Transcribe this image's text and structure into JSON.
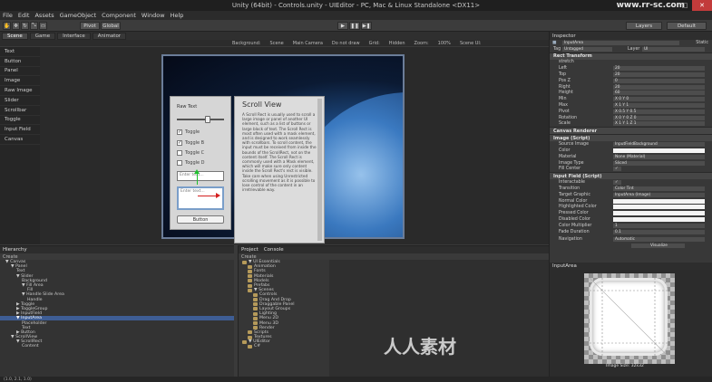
{
  "window": {
    "title": "Unity (64bit) - Controls.unity - UIEditor - PC, Mac & Linux Standalone <DX11>",
    "site": "www.rr-sc.com"
  },
  "menu": [
    "File",
    "Edit",
    "Assets",
    "GameObject",
    "Component",
    "Window",
    "Help"
  ],
  "toolbar": {
    "pivot": "Pivot",
    "global": "Global",
    "play": "▶",
    "pause": "❚❚",
    "step": "▶❚",
    "layers": "Layers",
    "layout": "Default"
  },
  "scene_tabs": [
    "Scene",
    "Game",
    "Interface",
    "Animator"
  ],
  "scene_options": {
    "background": "Background:",
    "scene": "Scene",
    "camera": "Main Camera",
    "do_not_draw": "Do not draw",
    "grid": "Grid:",
    "hidden": "Hidden",
    "zoom": "Zoom:",
    "zoom_val": "100%",
    "scene_ui": "Scene UI:"
  },
  "tools": [
    "Text",
    "Button",
    "Panel",
    "Image",
    "Raw Image",
    "Slider",
    "Scrollbar",
    "Toggle",
    "Input Field",
    "Canvas"
  ],
  "demo_ui": {
    "left_title": "Raw Text",
    "checkboxes": [
      "Toggle",
      "Toggle B",
      "Toggle C",
      "Toggle D"
    ],
    "input1": "Enter text...",
    "input2": "Enter text...",
    "button": "Button",
    "scroll_title": "Scroll View",
    "scroll_text": "A Scroll Rect is usually used to scroll a large image or panel of another UI element, such as a list of buttons or large block of text. The Scroll Rect is most often used with a mask element, and is designed to work seamlessly with scrollbars. To scroll content, the input must be received from inside the bounds of the ScrollRect, not on the content itself. The Scroll Rect is commonly used with a Mask element, which will make sure only content inside the Scroll Rect's rect is visible. Take care when using Unrestricted scrolling movement as it is possible to lose control of the content in an irretrievable way."
  },
  "inspector": {
    "tab": "Inspector",
    "name": "InputArea",
    "static": "Static",
    "tag": "Untagged",
    "layer": "UI",
    "rect_transform": "Rect Transform",
    "anchor_preset": "stretch",
    "rows": [
      {
        "label": "Left",
        "value": "20"
      },
      {
        "label": "Top",
        "value": "20"
      },
      {
        "label": "Pos Z",
        "value": "0"
      },
      {
        "label": "Right",
        "value": "20"
      },
      {
        "label": "Height",
        "value": "60"
      }
    ],
    "anchors": [
      {
        "label": "Min",
        "value": "X 0    Y 0"
      },
      {
        "label": "Max",
        "value": "X 1    Y 1"
      },
      {
        "label": "Pivot",
        "value": "X 0.5  Y 0.5"
      },
      {
        "label": "Rotation",
        "value": "X 0  Y 0  Z 0"
      },
      {
        "label": "Scale",
        "value": "X 1  Y 1  Z 1"
      }
    ],
    "canvas_renderer": "Canvas Renderer",
    "image_script": "Image (Script)",
    "image_rows": [
      {
        "label": "Source Image",
        "value": "InputFieldBackground"
      },
      {
        "label": "Color",
        "value": ""
      },
      {
        "label": "Material",
        "value": "None (Material)"
      },
      {
        "label": "Image Type",
        "value": "Sliced"
      },
      {
        "label": "Fill Center",
        "value": "✓"
      }
    ],
    "input_script": "Input Field (Script)",
    "input_rows": [
      {
        "label": "Interactable",
        "value": "✓"
      },
      {
        "label": "Transition",
        "value": "Color Tint"
      },
      {
        "label": "Target Graphic",
        "value": "InputArea (Image)"
      },
      {
        "label": "Normal Color",
        "value": ""
      },
      {
        "label": "Highlighted Color",
        "value": ""
      },
      {
        "label": "Pressed Color",
        "value": ""
      },
      {
        "label": "Disabled Color",
        "value": ""
      },
      {
        "label": "Color Multiplier",
        "value": "1"
      },
      {
        "label": "Fade Duration",
        "value": "0.1"
      }
    ],
    "navigation": "Navigation",
    "navigation_value": "Automatic",
    "visualize": "Visualize"
  },
  "hierarchy": {
    "tab": "Hierarchy",
    "create": "Create",
    "items": [
      {
        "label": "▼ Canvas",
        "indent": 0
      },
      {
        "label": "▼ Panel",
        "indent": 1
      },
      {
        "label": "Text",
        "indent": 2
      },
      {
        "label": "▼ Slider",
        "indent": 2
      },
      {
        "label": "Background",
        "indent": 3
      },
      {
        "label": "▼ Fill Area",
        "indent": 3
      },
      {
        "label": "Fill",
        "indent": 4
      },
      {
        "label": "▼ Handle Slide Area",
        "indent": 3
      },
      {
        "label": "Handle",
        "indent": 4
      },
      {
        "label": "▶ Toggle",
        "indent": 2
      },
      {
        "label": "▶ ToggleGroup",
        "indent": 2
      },
      {
        "label": "▶ InputField",
        "indent": 2
      },
      {
        "label": "▼ InputArea",
        "indent": 2,
        "selected": true
      },
      {
        "label": "Placeholder",
        "indent": 3
      },
      {
        "label": "Text",
        "indent": 3
      },
      {
        "label": "▶ Button",
        "indent": 2
      },
      {
        "label": "▼ ScrollView",
        "indent": 1
      },
      {
        "label": "▼ ScrollRect",
        "indent": 2
      },
      {
        "label": "Content",
        "indent": 3
      }
    ]
  },
  "project": {
    "tabs": [
      "Project",
      "Console"
    ],
    "create": "Create",
    "folders": [
      {
        "label": "▼ UI Essentials",
        "indent": 0
      },
      {
        "label": "Animation",
        "indent": 1
      },
      {
        "label": "Fonts",
        "indent": 1
      },
      {
        "label": "Materials",
        "indent": 1
      },
      {
        "label": "Models",
        "indent": 1
      },
      {
        "label": "Prefabs",
        "indent": 1
      },
      {
        "label": "▼ Scenes",
        "indent": 1
      },
      {
        "label": "Controls",
        "indent": 2
      },
      {
        "label": "Drag And Drop",
        "indent": 2
      },
      {
        "label": "Draggable Panel",
        "indent": 2
      },
      {
        "label": "Layout Groups",
        "indent": 2
      },
      {
        "label": "Lighting",
        "indent": 2
      },
      {
        "label": "Menu 2D",
        "indent": 2
      },
      {
        "label": "Menu 3D",
        "indent": 2
      },
      {
        "label": "Render",
        "indent": 2
      },
      {
        "label": "Scripts",
        "indent": 1
      },
      {
        "label": "Textures",
        "indent": 1
      },
      {
        "label": "▼ UIEditor",
        "indent": 0
      },
      {
        "label": "C#",
        "indent": 1
      }
    ]
  },
  "preview": {
    "title": "InputArea",
    "size": "Image Size: 32x32"
  },
  "status": "(1.0, 2.1, 1.0)",
  "watermark": "人人素材"
}
